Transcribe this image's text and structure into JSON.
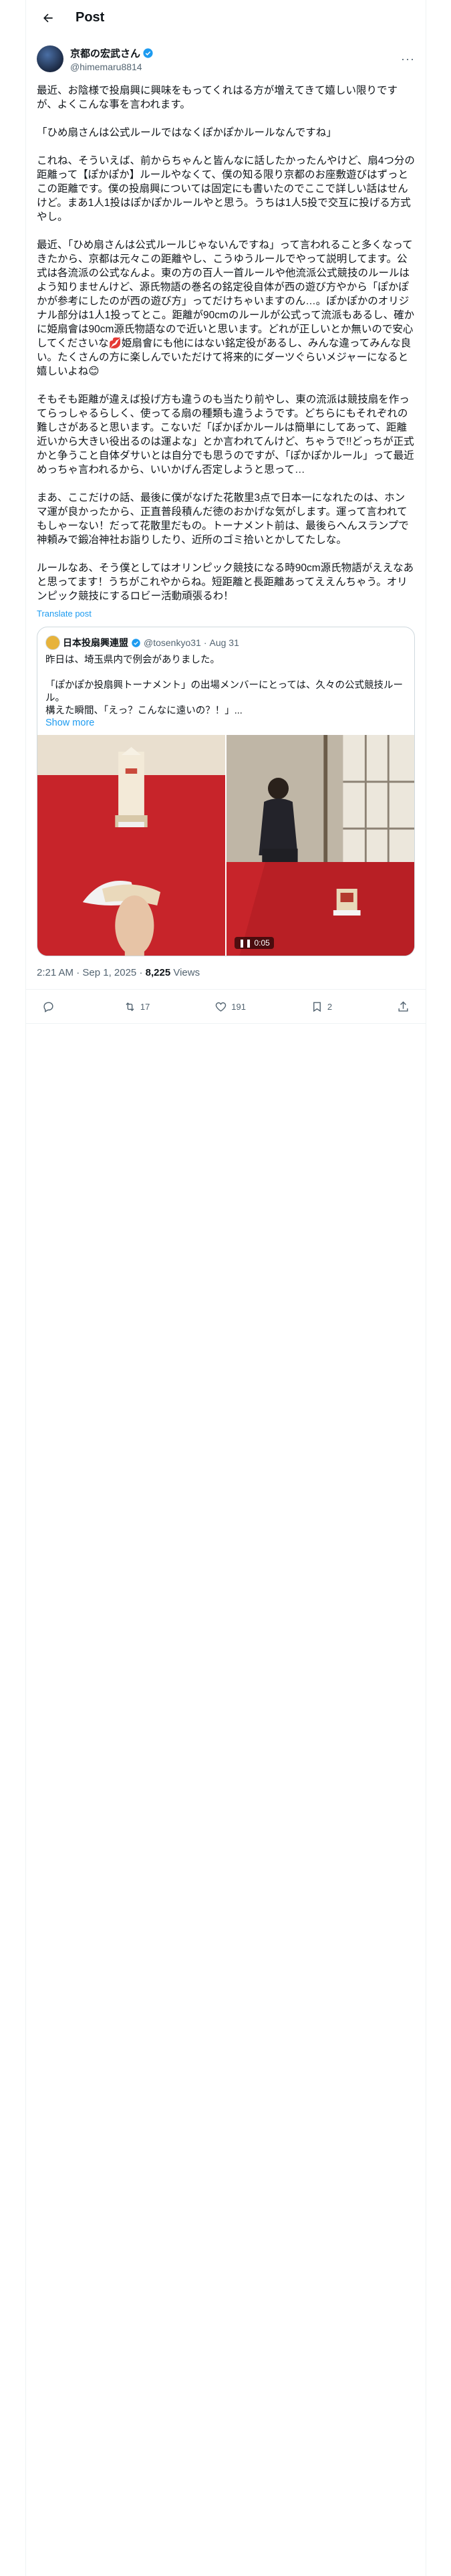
{
  "header": {
    "title": "Post"
  },
  "author": {
    "display_name": "京都の宏武さん",
    "handle": "@himemaru8814"
  },
  "post": {
    "text": "最近、お陰様で投扇興に興味をもってくれはる方が増えてきて嬉しい限りですが、よくこんな事を言われます。\n\n「ひめ扇さんは公式ルールではなくぽかぽかルールなんですね」\n\nこれね、そういえば、前からちゃんと皆んなに話したかったんやけど、扇4つ分の距離って【ぽかぽか】ルールやなくて、僕の知る限り京都のお座敷遊びはずっとこの距離です。僕の投扇興については固定にも書いたのでここで詳しい話はせんけど。まあ1人1投はぽかぽかルールやと思う。うちは1人5投で交互に投げる方式やし。\n\n最近、「ひめ扇さんは公式ルールじゃないんですね」って言われること多くなってきたから、京都は元々この距離やし、こうゆうルールでやって説明してます。公式は各流派の公式なんよ。東の方の百人一首ルールや他流派公式競技のルールはよう知りませんけど、源氏物語の巻名の銘定役自体が西の遊び方やから「ぽかぽかが参考にしたのが西の遊び方」ってだけちゃいますのん…。ぽかぽかのオリジナル部分は1人1投ってとこ。距離が90cmのルールが公式って流派もあるし、確かに姫扇會は90cm源氏物語なので近いと思います。どれが正しいとか無いので安心してくださいな💋姫扇會にも他にはない銘定役があるし、みんな違ってみんな良い。たくさんの方に楽しんでいただけて将来的にダーツぐらいメジャーになると嬉しいよね😊\n\nそもそも距離が違えば投げ方も違うのも当たり前やし、東の流派は競技扇を作ってらっしゃるらしく、使ってる扇の種類も違うようです。どちらにもそれぞれの難しさがあると思います。こないだ「ぽかぽかルールは簡単にしてあって、距離近いから大きい役出るのは運よな」とか言われてんけど、ちゃうで!!どっちが正式かと争うこと自体ダサいとは自分でも思うのですが、「ぽかぽかルール」って最近めっちゃ言われるから、いいかげん否定しようと思って…\n\nまあ、ここだけの話、最後に僕がなげた花散里3点で日本一になれたのは、ホンマ運が良かったから、正直普段積んだ徳のおかげな気がします。運って言われてもしゃーない！だって花散里だもの。トーナメント前は、最後らへんスランプで神頼みで鍛冶神社お詣りしたり、近所のゴミ拾いとかしてたしな。\n\nルールなあ、そう僕としてはオリンピック競技になる時90cm源氏物語がええなあと思ってます！うちがこれやからね。短距離と長距離あってええんちゃう。オリンピック競技にするロビー活動頑張るわ！",
    "translate_label": "Translate post",
    "timestamp": "2:21 AM · Sep 1, 2025",
    "views_count": "8,225",
    "views_label": "Views"
  },
  "quote": {
    "display_name": "日本投扇興連盟",
    "handle": "@tosenkyo31",
    "date": "Aug 31",
    "text": "昨日は、埼玉県内で例会がありました。\n\n「ぽかぽか投扇興トーナメント」の出場メンバーにとっては、久々の公式競技ルール。\n構えた瞬間、「えっ？こんなに遠いの？！」...",
    "show_more": "Show more",
    "video_duration": "0:05"
  },
  "actions": {
    "replies": "",
    "reposts": "17",
    "likes": "191",
    "bookmarks": "2"
  },
  "colors": {
    "accent": "#1d9bf0",
    "verified": "#1d9bf0",
    "mat_red": "#c7242a"
  }
}
